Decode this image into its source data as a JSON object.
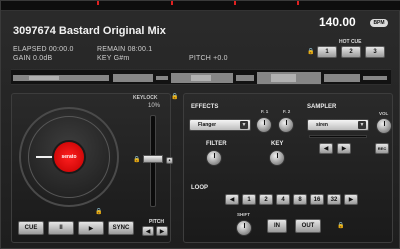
{
  "track": {
    "title": "3097674 Bastard Original Mix",
    "elapsed": "ELAPSED 00:00.0",
    "remain": "REMAIN 08:00.1",
    "gain": "GAIN 0.0dB",
    "key": "KEY G#m",
    "pitch": "PITCH +0.0"
  },
  "tempo": {
    "bpm": "140.00",
    "bpm_tag": "BPM"
  },
  "hotcue": {
    "label": "HOT CUE",
    "buttons": [
      "1",
      "2",
      "3"
    ]
  },
  "jog": {
    "center_label": "serato"
  },
  "pitch_slider": {
    "keylock_label": "KEYLOCK",
    "range_label": "10%",
    "pitch_label": "PITCH",
    "nudge_left": "◀",
    "nudge_right": "▶"
  },
  "transport": {
    "cue": "CUE",
    "pause": "II",
    "play": "▶",
    "sync": "SYNC"
  },
  "effects": {
    "label": "EFFECTS",
    "selected": "Flanger",
    "f1_label": "F. 1",
    "f2_label": "F. 2",
    "filter_label": "FILTER",
    "key_label": "KEY"
  },
  "sampler": {
    "label": "SAMPLER",
    "selected": "siren",
    "vol_label": "VOL",
    "rec_label": "REC",
    "prev": "◀",
    "next": "▶"
  },
  "loop": {
    "label": "LOOP",
    "prev": "◀",
    "sizes": [
      "1",
      "2",
      "4",
      "8",
      "16",
      "32"
    ],
    "next": "▶",
    "shift_label": "SHIFT",
    "in_label": "IN",
    "out_label": "OUT"
  },
  "colors": {
    "accent_red": "#e02020",
    "platter_center": "#d00000"
  }
}
